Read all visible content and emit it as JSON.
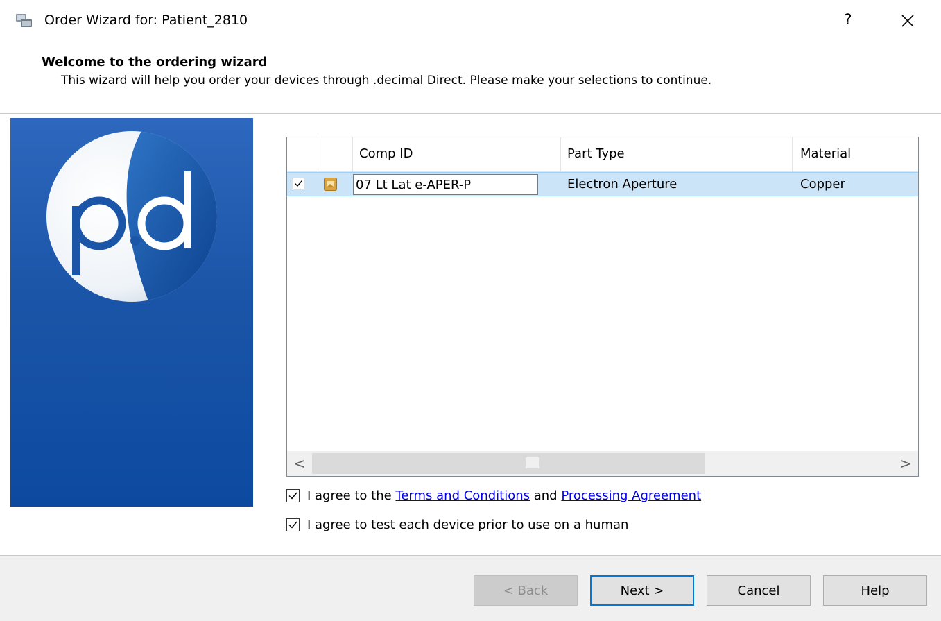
{
  "window": {
    "title": "Order Wizard for: Patient_2810",
    "help_label": "?",
    "app_icon": "wizard-app-icon",
    "close_icon": "close-icon"
  },
  "header": {
    "title": "Welcome to the ordering wizard",
    "subtitle": "This wizard will help you order your devices through .decimal Direct. Please make your selections to continue."
  },
  "side_panel": {
    "logo_icon": "pd-logo-icon",
    "colors": {
      "panel": "#1b55a8",
      "logo_dark": "#0c4aa0"
    }
  },
  "grid": {
    "columns": [
      "Comp ID",
      "Part Type",
      "Material"
    ],
    "rows": [
      {
        "checked": true,
        "icon": "device-file-icon",
        "comp_id": "07 Lt Lat e-APER-P",
        "part_type": "Electron Aperture",
        "material": "Copper"
      }
    ],
    "scroll_left": "<",
    "scroll_right": ">",
    "selection_color": "#cce4f7"
  },
  "agreements": {
    "terms": {
      "checked": true,
      "prefix": "I agree to the ",
      "link1": "Terms and Conditions",
      "middle": " and ",
      "link2": "Processing Agreement"
    },
    "test": {
      "checked": true,
      "label": "I agree to test each device prior to use on a human"
    }
  },
  "buttons": {
    "back": "< Back",
    "next": "Next >",
    "cancel": "Cancel",
    "help": "Help"
  }
}
